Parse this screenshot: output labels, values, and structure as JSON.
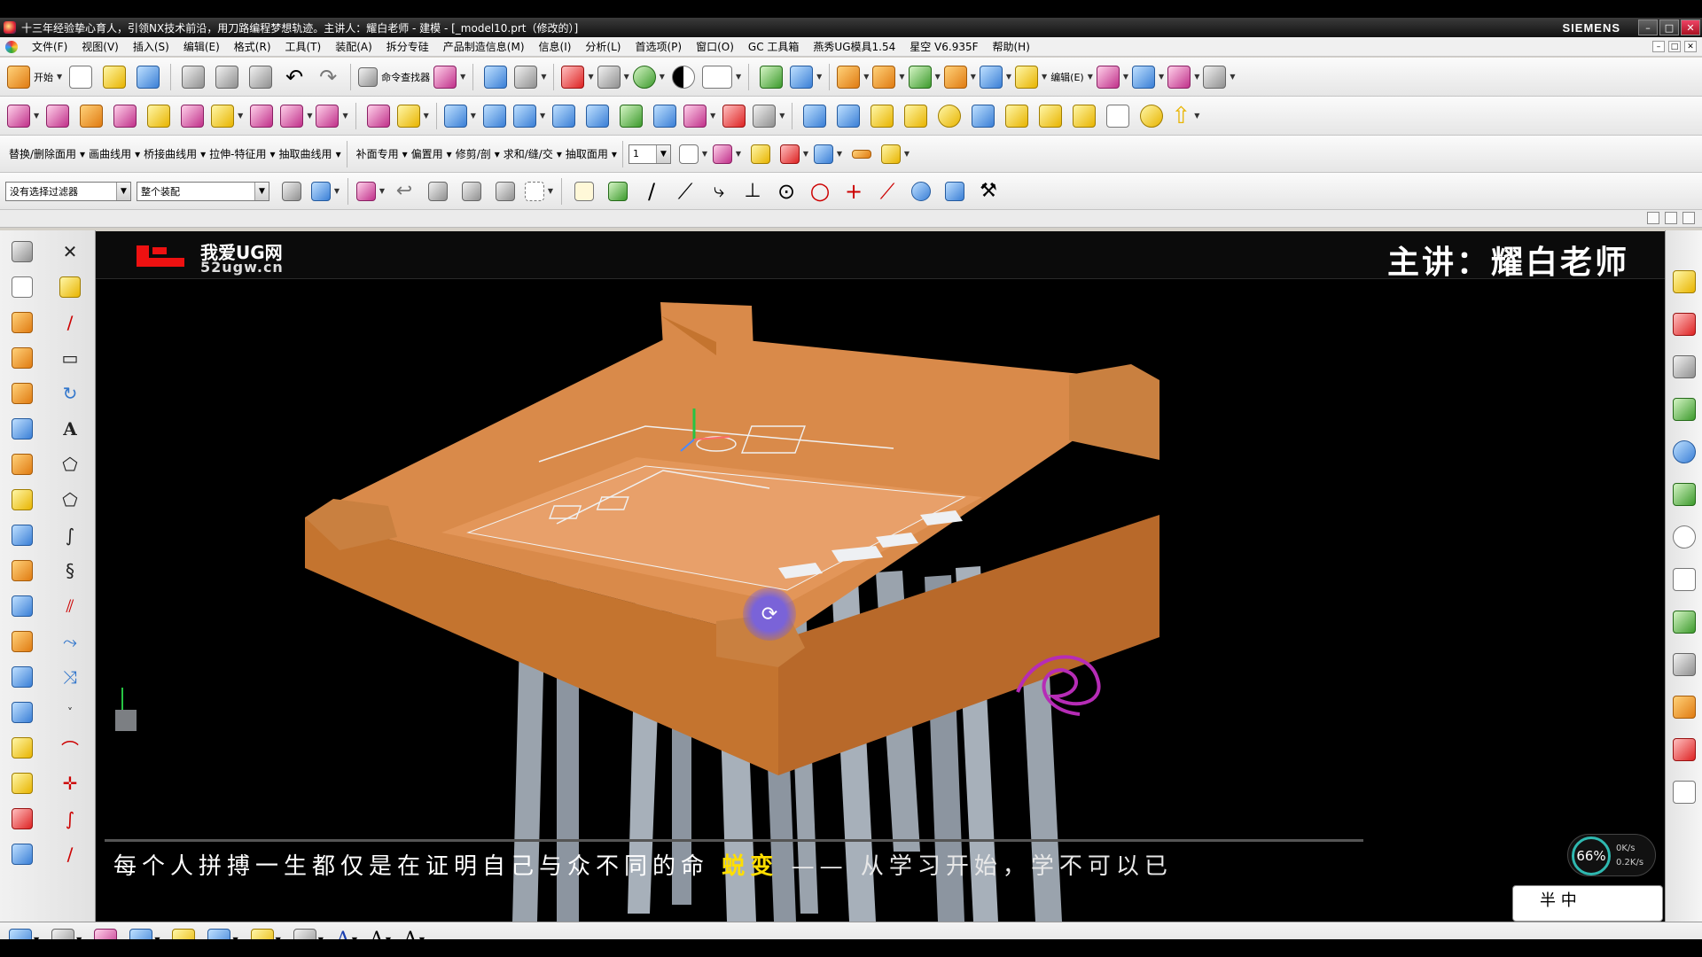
{
  "window": {
    "title": "十三年经验挚心育人，引领NX技术前沿，用刀路编程梦想轨迹。主讲人：耀白老师 - 建模 - [_model10.prt（修改的）]",
    "brand": "SIEMENS",
    "controls": [
      "–",
      "□",
      "✕"
    ]
  },
  "menubar": {
    "items": [
      "文件(F)",
      "视图(V)",
      "插入(S)",
      "编辑(E)",
      "格式(R)",
      "工具(T)",
      "装配(A)",
      "拆分专硅",
      "产品制造信息(M)",
      "信息(I)",
      "分析(L)",
      "首选项(P)",
      "窗口(O)",
      "GC 工具箱",
      "燕秀UG模具1.54",
      "星空 V6.935F",
      "帮助(H)"
    ]
  },
  "toolbar1": {
    "start_label": "开始",
    "command_finder_label": "命令查找器",
    "edit_label": "编辑(E)"
  },
  "toolbar3": {
    "menus": [
      "替换/删除面用",
      "画曲线用",
      "桥接曲线用",
      "拉伸-特征用",
      "抽取曲线用",
      "补面专用",
      "偏置用",
      "修剪/剖",
      "求和/缝/交",
      "抽取面用"
    ],
    "layer_value": "1"
  },
  "toolbar4": {
    "filter_value": "没有选择过滤器",
    "scope_value": "整个装配"
  },
  "viewport": {
    "logo_cn": "我爱UG网",
    "logo_url": "52ugw.cn",
    "presenter": "主讲：耀白老师",
    "subtitle_pre": "每个人拼搏一生都仅是在证明自己与众不同的命",
    "subtitle_highlight": "蜕变",
    "subtitle_post": "—— 从学习开始，学不可以已",
    "perf_percent": "66%",
    "perf_up": "0K/s",
    "perf_down": "0.2K/s",
    "overlay_text": "半 中"
  },
  "colors": {
    "model_top": "#d98a4a",
    "model_side": "#c77736",
    "pins": "#9aa3ad",
    "accent": "#ffde00"
  }
}
